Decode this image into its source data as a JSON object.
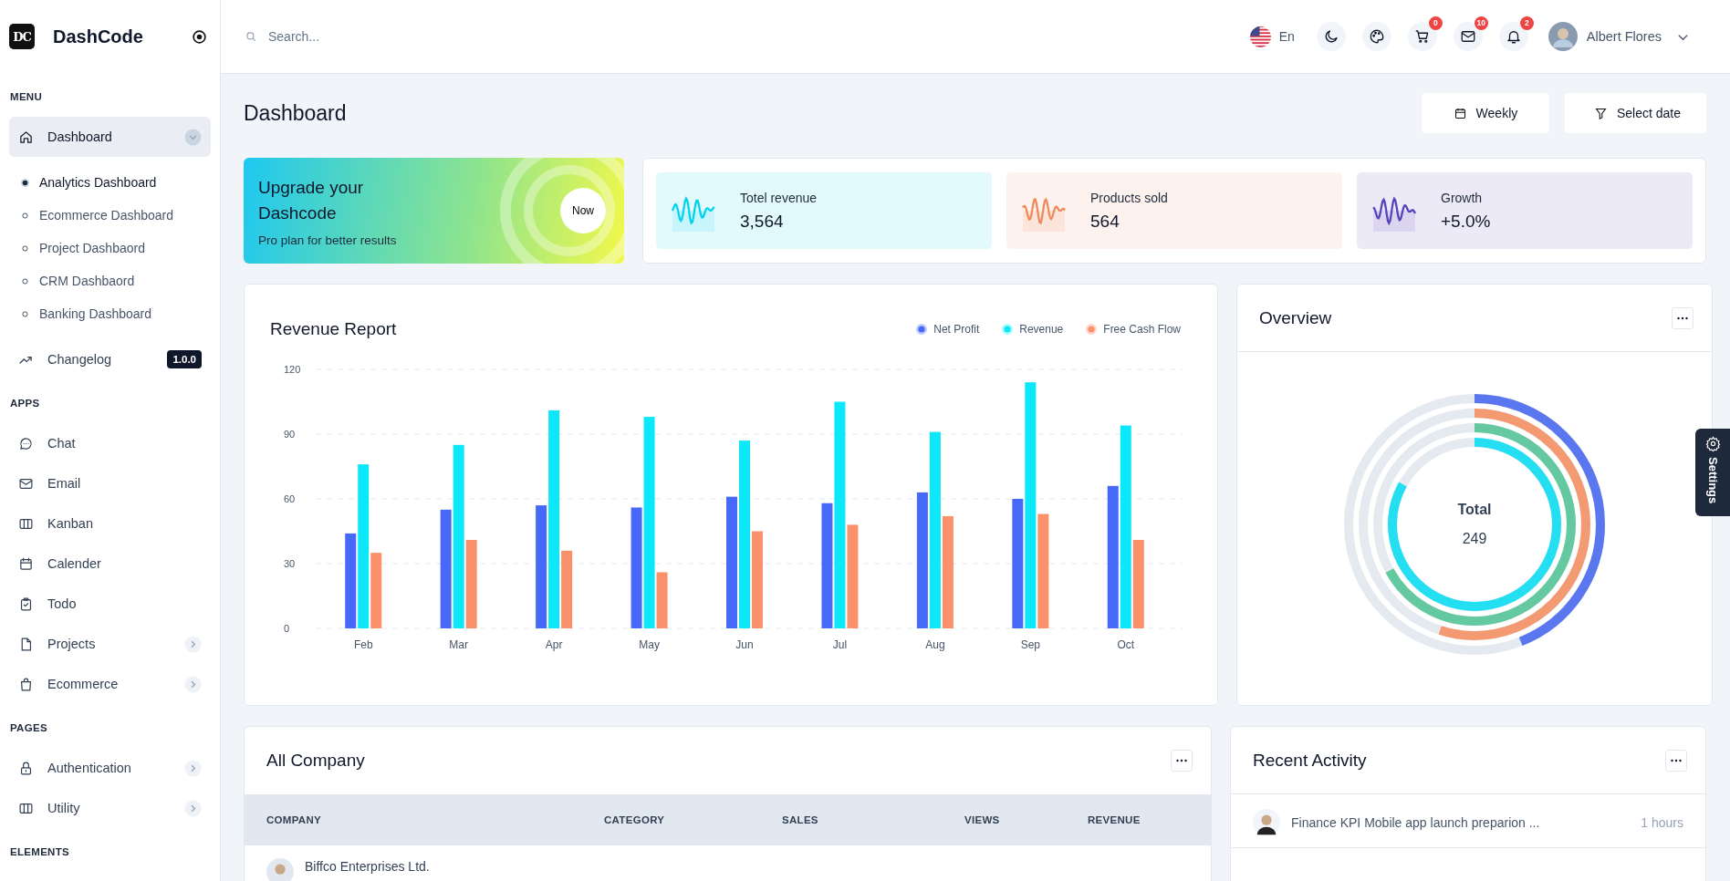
{
  "brand": {
    "logo": "DC",
    "name": "DashCode"
  },
  "sidebar": {
    "sections": [
      {
        "title": "MENU",
        "items": [
          {
            "kind": "group",
            "label": "Dashboard",
            "selected": true,
            "expanded": true,
            "children": [
              {
                "label": "Analytics Dashboard",
                "selected": true
              },
              {
                "label": "Ecommerce Dashboard",
                "selected": false
              },
              {
                "label": "Project Dashbaord",
                "selected": false
              },
              {
                "label": "CRM Dashbaord",
                "selected": false
              },
              {
                "label": "Banking Dashboard",
                "selected": false
              }
            ]
          },
          {
            "kind": "link",
            "label": "Changelog",
            "selected": false,
            "badge": "1.0.0"
          }
        ]
      },
      {
        "title": "APPS",
        "items": [
          {
            "kind": "link",
            "label": "Chat",
            "selected": false
          },
          {
            "kind": "link",
            "label": "Email",
            "selected": false
          },
          {
            "kind": "link",
            "label": "Kanban",
            "selected": false
          },
          {
            "kind": "link",
            "label": "Calender",
            "selected": false
          },
          {
            "kind": "link",
            "label": "Todo",
            "selected": false
          },
          {
            "kind": "group",
            "label": "Projects",
            "selected": false,
            "expanded": false
          },
          {
            "kind": "group",
            "label": "Ecommerce",
            "selected": false,
            "expanded": false
          }
        ]
      },
      {
        "title": "PAGES",
        "items": [
          {
            "kind": "group",
            "label": "Authentication",
            "selected": false,
            "expanded": false
          },
          {
            "kind": "group",
            "label": "Utility",
            "selected": false,
            "expanded": false
          }
        ]
      },
      {
        "title": "ELEMENTS"
      }
    ]
  },
  "header": {
    "search": {
      "placeholder": "Search..."
    },
    "language": "En",
    "notifications": [
      {
        "badge": "0"
      },
      {
        "badge": "10"
      },
      {
        "badge": "2"
      }
    ],
    "user": {
      "name": "Albert Flores"
    }
  },
  "page": {
    "title": "Dashboard",
    "buttons": [
      "Weekly",
      "Select date"
    ]
  },
  "promo": {
    "title": "Upgrade your Dashcode",
    "subtitle": "Pro plan for better results",
    "button": "Now"
  },
  "stats": [
    {
      "label": "Totel revenue",
      "value": "3,564",
      "color": "#00d2f0"
    },
    {
      "label": "Products sold",
      "value": "564",
      "color": "#f08a5d"
    },
    {
      "label": "Growth",
      "value": "+5.0%",
      "color": "#5743be"
    }
  ],
  "revenue_report": {
    "title": "Revenue Report",
    "chart_data": {
      "type": "bar",
      "categories": [
        "Feb",
        "Mar",
        "Apr",
        "May",
        "Jun",
        "Jul",
        "Aug",
        "Sep",
        "Oct"
      ],
      "ylim": [
        0,
        120
      ],
      "grid": true,
      "yticks": [
        0,
        30,
        60,
        90,
        120
      ],
      "series": [
        {
          "name": "Net Profit",
          "color": "#4669fa",
          "values": [
            44,
            55,
            57,
            56,
            61,
            58,
            63,
            60,
            66
          ]
        },
        {
          "name": "Revenue",
          "color": "#0ce7fa",
          "values": [
            76,
            85,
            101,
            98,
            87,
            105,
            91,
            114,
            94
          ]
        },
        {
          "name": "Free Cash Flow",
          "color": "#fa916b",
          "values": [
            35,
            41,
            36,
            26,
            45,
            48,
            52,
            53,
            41
          ]
        }
      ]
    }
  },
  "overview": {
    "title": "Overview",
    "total_label": "Total",
    "total_value": "249"
  },
  "settings_tab": {
    "label": "Settings"
  },
  "all_company": {
    "title": "All Company",
    "columns": [
      "COMPANY",
      "CATEGORY",
      "SALES",
      "VIEWS",
      "REVENUE"
    ],
    "rows": [
      {
        "company": "Biffco Enterprises Ltd."
      }
    ]
  },
  "recent_activity": {
    "title": "Recent Activity",
    "items": [
      {
        "text": "Finance KPI Mobile app launch preparion ...",
        "time": "1 hours"
      }
    ]
  }
}
